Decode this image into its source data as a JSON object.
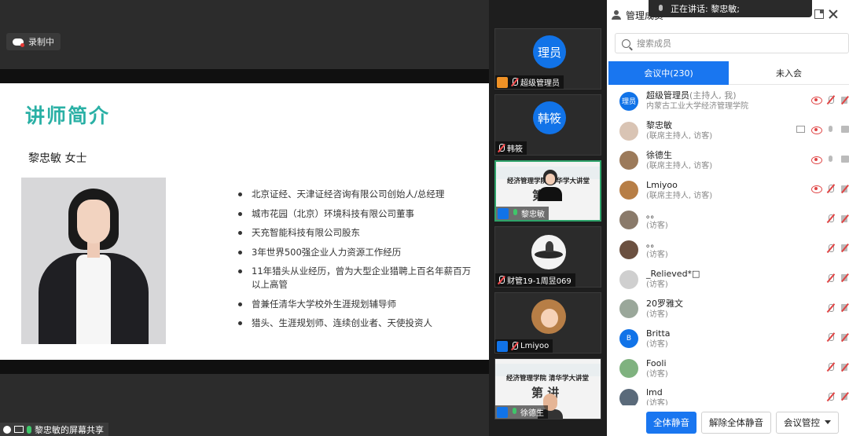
{
  "stage": {
    "recording_label": "录制中",
    "share_label": "黎忠敏的屏幕共享"
  },
  "slide": {
    "title": "讲师简介",
    "speaker": "黎忠敏  女士",
    "bullets": [
      "北京证经、天津证经咨询有限公司创始人/总经理",
      "城市花园（北京）环境科技有限公司董事",
      "天充智能科技有限公司股东",
      "3年世界500强企业人力资源工作经历",
      "11年猎头从业经历，曾为大型企业猎聘上百名年薪百万以上高管",
      "曾兼任清华大学校外生涯规划辅导师",
      "猎头、生涯规划师、连续创业者、天使投资人"
    ]
  },
  "videos": [
    {
      "avatar_text": "理员",
      "caption": "超级管理员"
    },
    {
      "avatar_text": "韩筱",
      "caption": "韩筱"
    },
    {
      "caption": "黎忠敏",
      "slide_text": "经济管理学院 清华学大讲堂",
      "brush_text": "第 讲"
    },
    {
      "caption": "财管19-1周昱069"
    },
    {
      "caption": "Lmiyoo"
    },
    {
      "caption": "徐德生",
      "slide_text": "经济管理学院 清华学大讲堂",
      "brush_text": "第 讲"
    }
  ],
  "speaking_toast": "正在讲话: 黎忠敏;",
  "panel": {
    "title": "管理成员",
    "search_placeholder": "搜索成员",
    "tabs": {
      "in_meeting": "会议中(230)",
      "not_joined": "未入会"
    },
    "members": [
      {
        "avatar_text": "理员",
        "name": "超级管理员",
        "host_note": "(主持人, 我)",
        "role": "内蒙古工业大学经济管理学院"
      },
      {
        "name": "黎忠敏",
        "role": "(联席主持人, 访客)"
      },
      {
        "name": "徐德生",
        "role": "(联席主持人, 访客)"
      },
      {
        "name": "Lmiyoo",
        "role": "(联席主持人, 访客)"
      },
      {
        "name": "。。",
        "role": "(访客)"
      },
      {
        "name": "。。",
        "role": "(访客)"
      },
      {
        "name": "_Relieved*□",
        "role": "(访客)"
      },
      {
        "name": "20罗雅文",
        "role": "(访客)"
      },
      {
        "avatar_text": "B",
        "name": "Britta",
        "role": "(访客)"
      },
      {
        "name": "Fooli",
        "role": "(访客)"
      },
      {
        "name": "lmd",
        "role": "(访客)"
      }
    ],
    "footer": {
      "mute_all": "全体静音",
      "unmute_all": "解除全体静音",
      "control": "会议管控"
    }
  },
  "colors": {
    "accent": "#1976f0",
    "title_teal": "#2ab0a5",
    "muted_red": "#e04444",
    "active_green": "#2ea36a"
  }
}
